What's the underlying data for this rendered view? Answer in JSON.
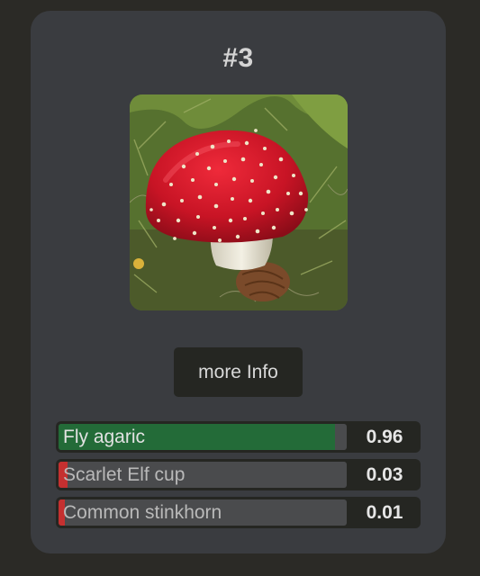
{
  "card": {
    "rank_label": "#3",
    "image_icon": "fly-agaric-mushroom-photo",
    "more_info_label": "more Info"
  },
  "predictions": [
    {
      "label": "Fly agaric",
      "value": "0.96",
      "score": 0.96,
      "color": "#236b38",
      "label_color": "#e2e2e2"
    },
    {
      "label": "Scarlet Elf cup",
      "value": "0.03",
      "score": 0.03,
      "color": "#c53030",
      "label_color": "#b9b9b9"
    },
    {
      "label": "Common stinkhorn",
      "value": "0.01",
      "score": 0.01,
      "color": "#c53030",
      "label_color": "#b9b9b9"
    }
  ]
}
